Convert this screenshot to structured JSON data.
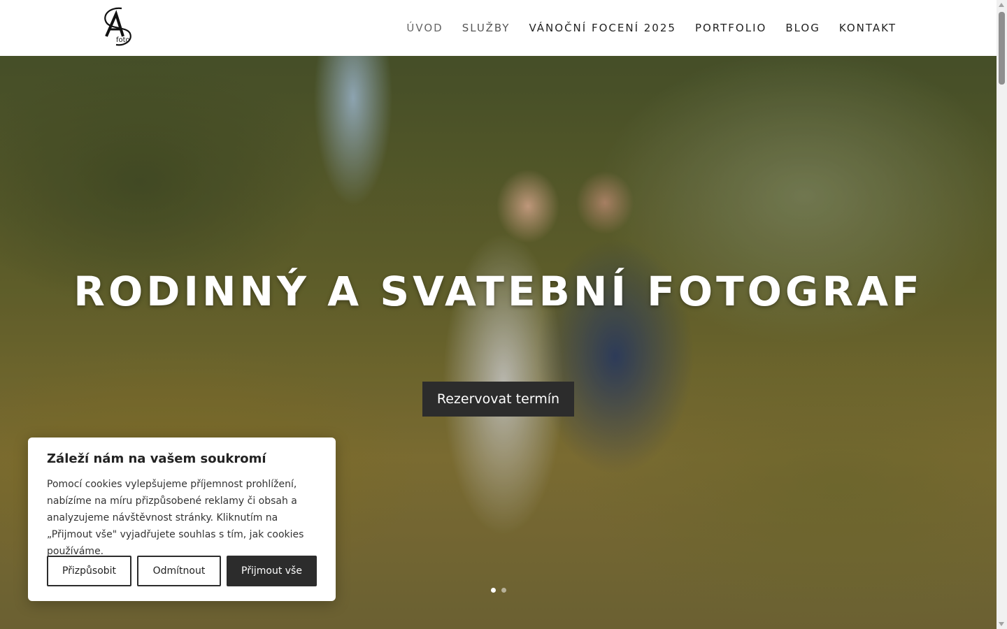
{
  "header": {
    "logo_text": "foto",
    "nav": [
      {
        "label": "ÚVOD"
      },
      {
        "label": "SLUŽBY"
      },
      {
        "label": "VÁNOČNÍ FOCENÍ 2025"
      },
      {
        "label": "PORTFOLIO"
      },
      {
        "label": "BLOG"
      },
      {
        "label": "KONTAKT"
      }
    ]
  },
  "hero": {
    "title": "RODINNÝ A SVATEBNÍ FOTOGRAF",
    "cta_label": "Rezervovat termín",
    "slides": 2,
    "active_slide": 1
  },
  "cookie": {
    "heading": "Záleží nám na vašem soukromí",
    "text": "Pomocí cookies vylepšujeme příjemnost prohlížení, nabízíme na míru přizpůsobené reklamy či obsah a analyzujeme návštěvnost stránky. Kliknutím na „Přijmout vše\" vyjadřujete souhlas s tím, jak cookies používáme.",
    "customize_label": "Přizpůsobit",
    "reject_label": "Odmítnout",
    "accept_label": "Přijmout vše"
  },
  "colors": {
    "dark_button": "#2c2c2c",
    "nav_text": "#222222",
    "nav_active": "#666666"
  }
}
